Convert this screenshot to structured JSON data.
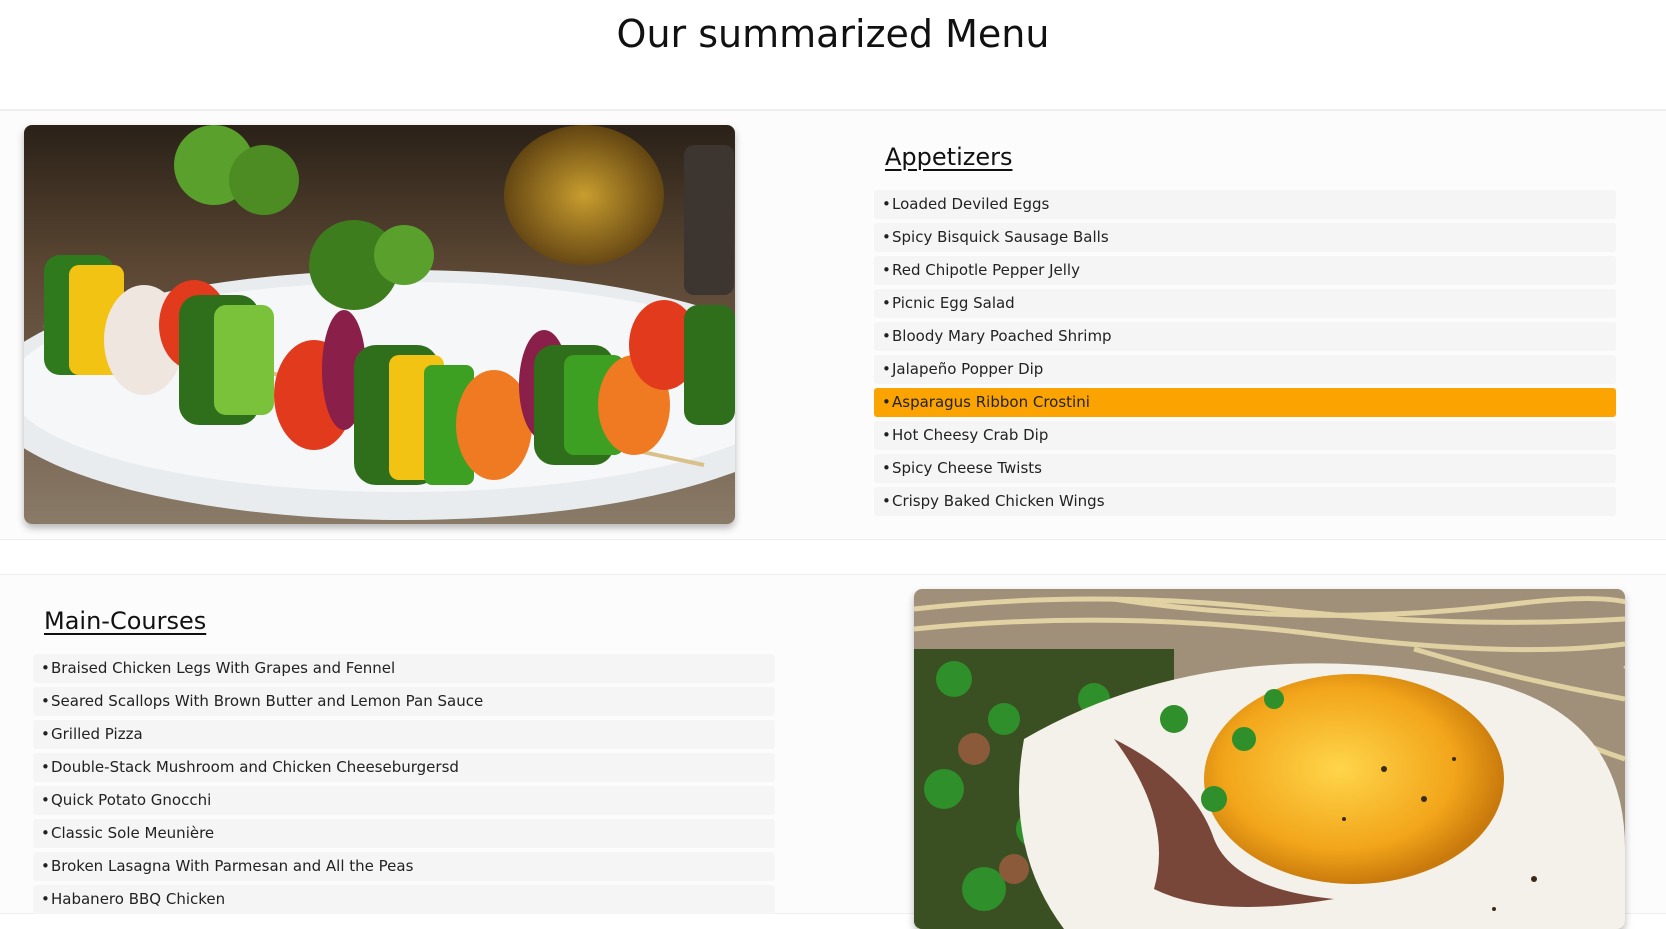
{
  "page": {
    "title": "Our summarized Menu"
  },
  "colors": {
    "highlight": "#fba301",
    "item_background": "#f5f5f5",
    "section_background": "#fcfcfc"
  },
  "appetizers": {
    "heading": "Appetizers",
    "image": "vegetable-skewers-photo",
    "highlighted_index": 6,
    "items": [
      {
        "bullet": "•",
        "label": "Loaded Deviled Eggs"
      },
      {
        "bullet": "•",
        "label": "Spicy Bisquick Sausage Balls"
      },
      {
        "bullet": "•",
        "label": "Red Chipotle Pepper Jelly"
      },
      {
        "bullet": "•",
        "label": "Picnic Egg Salad"
      },
      {
        "bullet": "•",
        "label": "Bloody Mary Poached Shrimp"
      },
      {
        "bullet": "•",
        "label": "Jalapeño Popper Dip"
      },
      {
        "bullet": "•",
        "label": "Asparagus Ribbon Crostini"
      },
      {
        "bullet": "•",
        "label": "Hot Cheesy Crab Dip"
      },
      {
        "bullet": "•",
        "label": "Spicy Cheese Twists"
      },
      {
        "bullet": "•",
        "label": "Crispy Baked Chicken Wings"
      }
    ]
  },
  "main_courses": {
    "heading": "Main-Courses",
    "image": "fried-egg-noodles-photo",
    "items": [
      {
        "bullet": "•",
        "label": "Braised Chicken Legs With Grapes and Fennel"
      },
      {
        "bullet": "•",
        "label": "Seared Scallops With Brown Butter and Lemon Pan Sauce"
      },
      {
        "bullet": "•",
        "label": "Grilled Pizza"
      },
      {
        "bullet": "•",
        "label": "Double-Stack Mushroom and Chicken Cheeseburgersd"
      },
      {
        "bullet": "•",
        "label": "Quick Potato Gnocchi"
      },
      {
        "bullet": "•",
        "label": "Classic Sole Meunière"
      },
      {
        "bullet": "•",
        "label": "Broken Lasagna With Parmesan and All the Peas"
      },
      {
        "bullet": "•",
        "label": "Habanero BBQ Chicken"
      }
    ]
  }
}
